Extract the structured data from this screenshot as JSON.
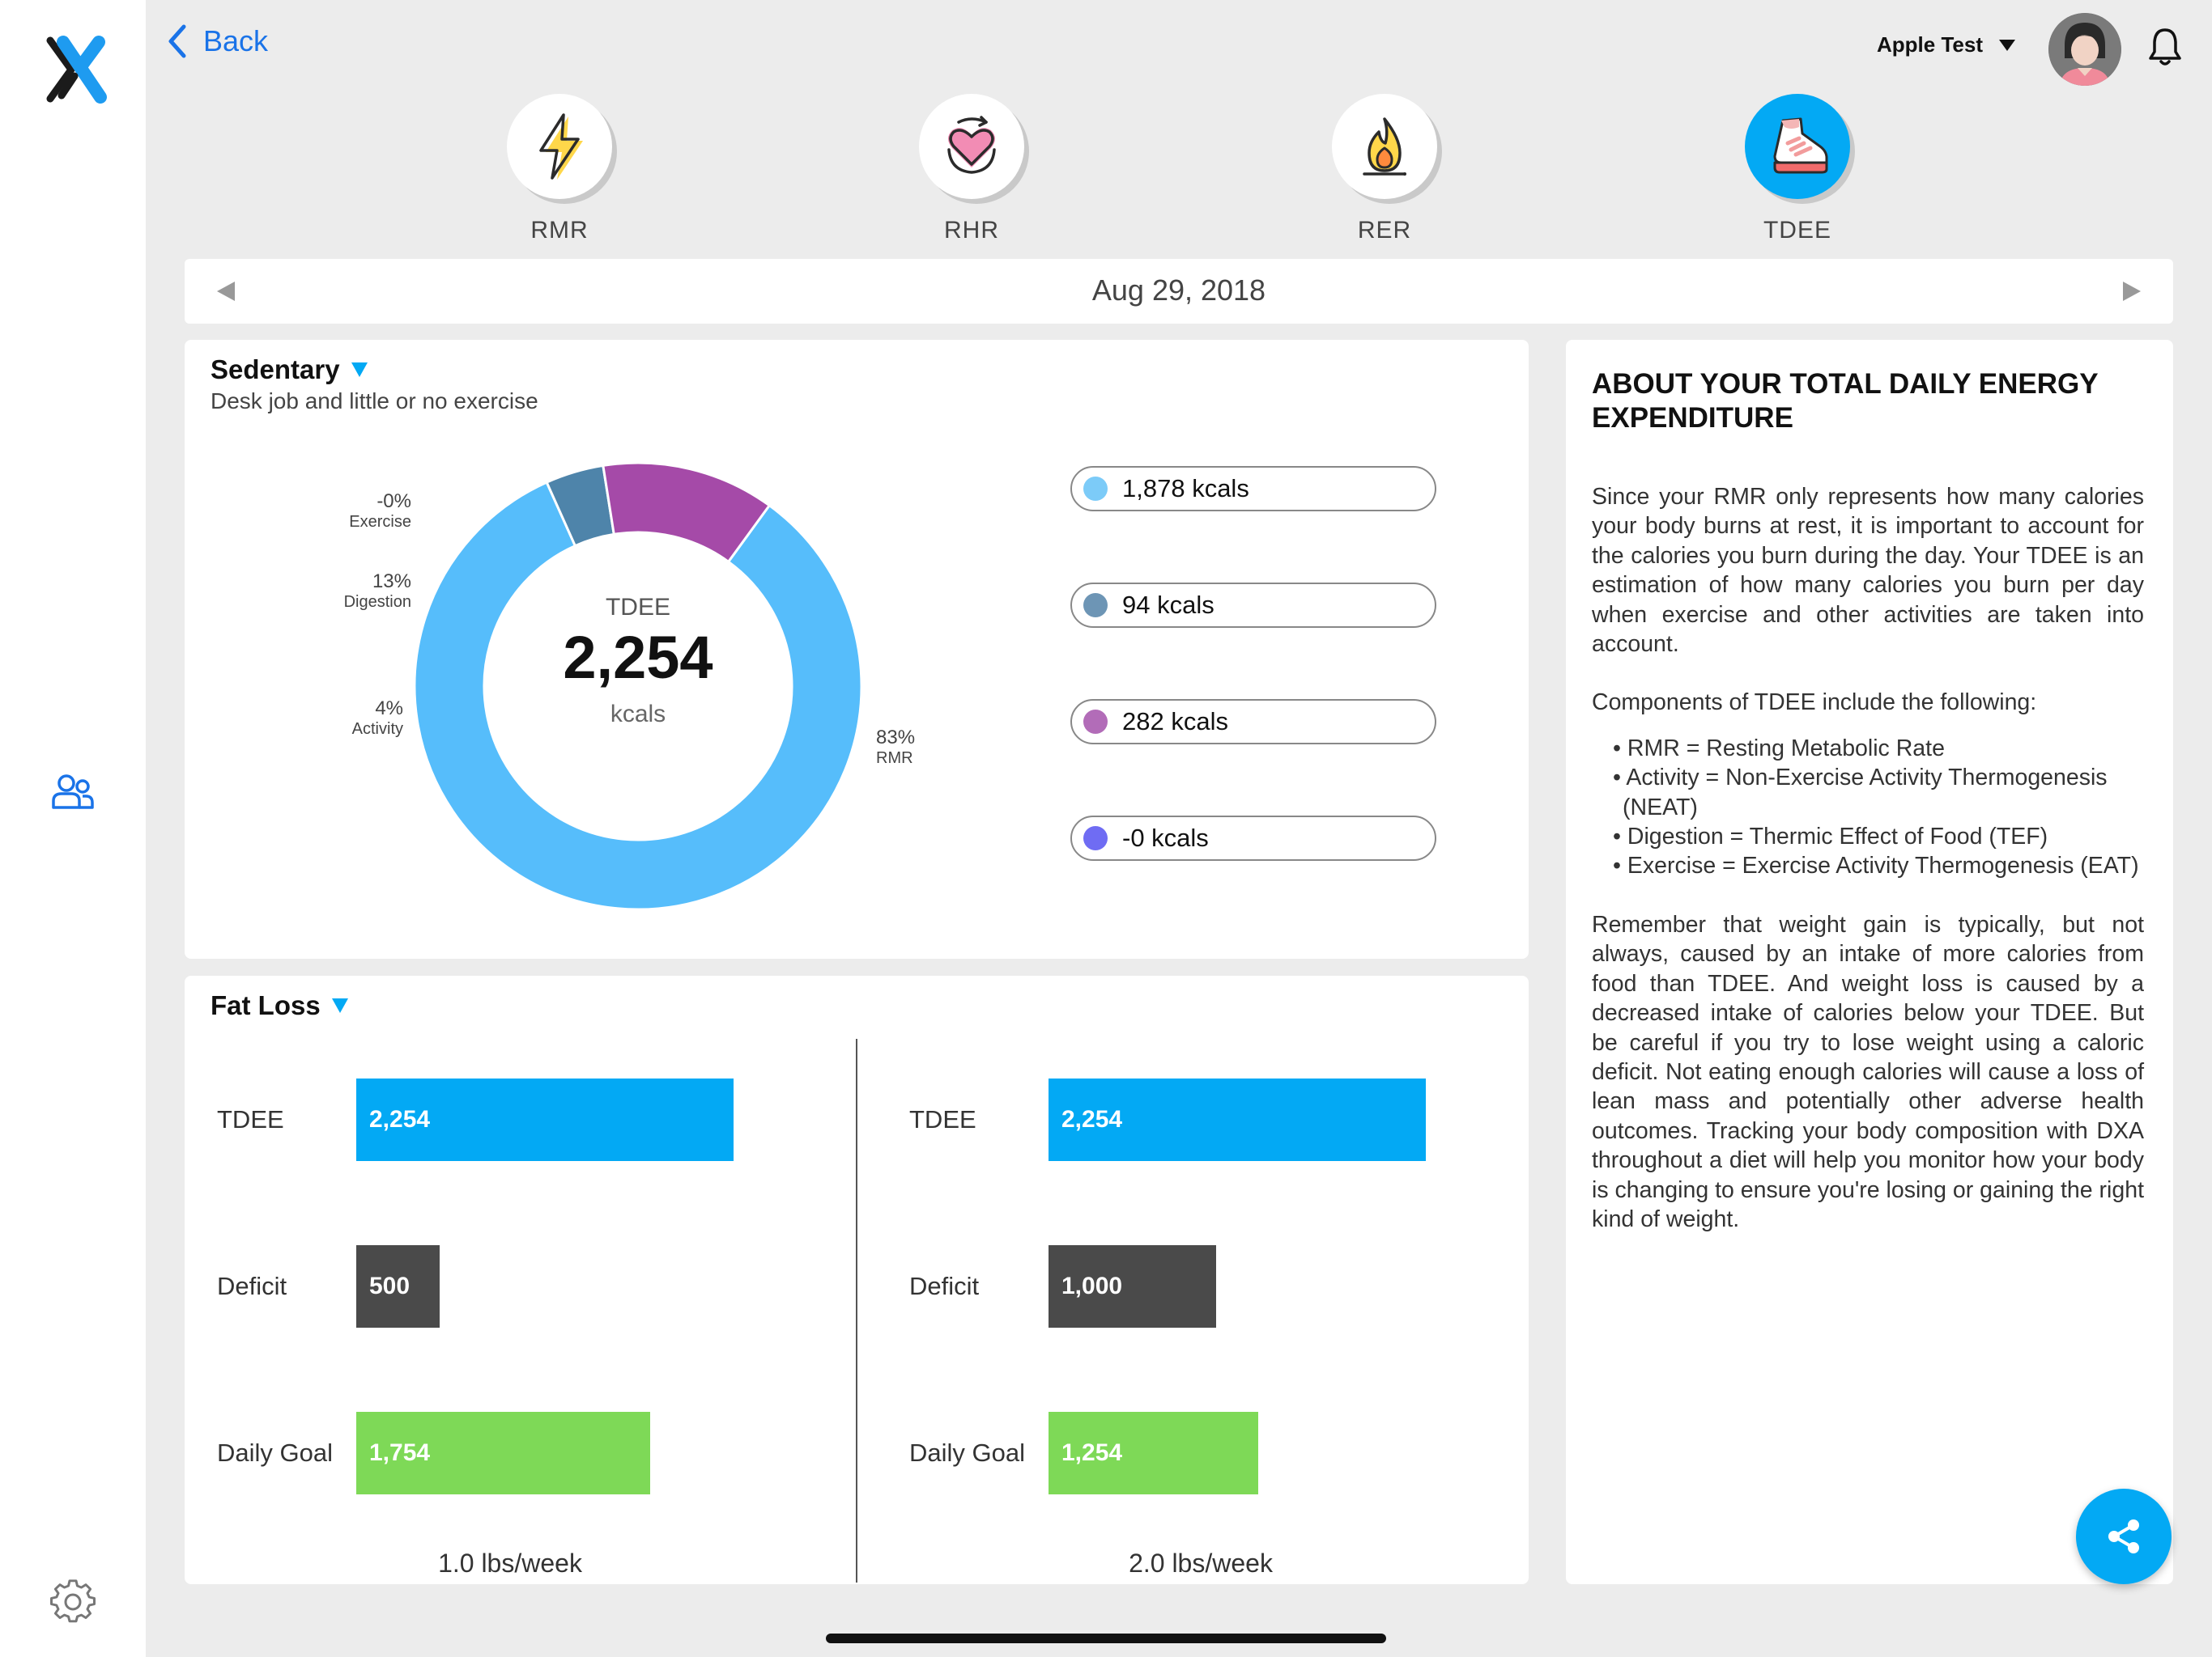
{
  "nav": {
    "back_label": "Back",
    "account_name": "Apple Test"
  },
  "metrics": [
    {
      "label": "RMR",
      "icon": "lightning-icon",
      "active": false
    },
    {
      "label": "RHR",
      "icon": "heart-rate-icon",
      "active": false
    },
    {
      "label": "RER",
      "icon": "flame-icon",
      "active": false
    },
    {
      "label": "TDEE",
      "icon": "running-shoe-icon",
      "active": true
    }
  ],
  "date": "Aug 29, 2018",
  "activity_level": {
    "title": "Sedentary",
    "description": "Desk job and little or no exercise"
  },
  "tdee": {
    "title": "TDEE",
    "value": "2,254",
    "unit": "kcals",
    "segments": [
      {
        "pct_label": "83%",
        "name": "RMR",
        "kcals": "1,878 kcals",
        "fraction": 0.833,
        "color": "#56bdfb",
        "legend_color": "#7ccbf8"
      },
      {
        "pct_label": "4%",
        "name": "Activity",
        "kcals": "94 kcals",
        "fraction": 0.042,
        "color": "#4e84aa",
        "legend_color": "#6d95b5"
      },
      {
        "pct_label": "13%",
        "name": "Digestion",
        "kcals": "282 kcals",
        "fraction": 0.125,
        "color": "#a54aa8",
        "legend_color": "#b26cb8"
      },
      {
        "pct_label": "-0%",
        "name": "Exercise",
        "kcals": "-0 kcals",
        "fraction": 0.0,
        "color": "#6f6cf3",
        "legend_color": "#6f6cf3"
      }
    ]
  },
  "fat_loss": {
    "title": "Fat Loss",
    "plans": [
      {
        "rows": [
          {
            "label": "TDEE",
            "value": "2,254",
            "amount": 2254,
            "color": "#03a9f4"
          },
          {
            "label": "Deficit",
            "value": "500",
            "amount": 500,
            "color": "#4a4a4a"
          },
          {
            "label": "Daily Goal",
            "value": "1,754",
            "amount": 1754,
            "color": "#7ed957"
          }
        ],
        "rate": "1.0 lbs/week"
      },
      {
        "rows": [
          {
            "label": "TDEE",
            "value": "2,254",
            "amount": 2254,
            "color": "#03a9f4"
          },
          {
            "label": "Deficit",
            "value": "1,000",
            "amount": 1000,
            "color": "#4a4a4a"
          },
          {
            "label": "Daily Goal",
            "value": "1,254",
            "amount": 1254,
            "color": "#7ed957"
          }
        ],
        "rate": "2.0 lbs/week"
      }
    ]
  },
  "about": {
    "title": "ABOUT YOUR TOTAL DAILY ENERGY EXPENDITURE",
    "p1": "Since your RMR only represents how many calories your body burns at rest, it is important to account for the calories you burn during the day. Your TDEE is an estimation of how many calories you burn per day when exercise and other activities are taken into account.",
    "p2": "Components of TDEE include the following:",
    "list": [
      "• RMR = Resting Metabolic Rate",
      "• Activity = Non-Exercise Activity Thermogenesis (NEAT)",
      "• Digestion = Thermic Effect of Food (TEF)",
      "• Exercise = Exercise Activity Thermogenesis (EAT)"
    ],
    "p3": "Remember that weight gain is typically, but not always, caused by an intake of more calories from food than TDEE. And weight loss is caused by a decreased intake of calories below your TDEE. But be careful if you try to lose weight using a caloric deficit. Not eating enough calories will cause a loss of lean mass and potentially other adverse health outcomes. Tracking your body composition with DXA throughout a diet will help you monitor how your body is changing to ensure you're losing or gaining the right kind of weight."
  },
  "icons": {
    "logo": "app-logo",
    "users": "users-icon",
    "settings": "gear-icon",
    "notifications": "bell-icon",
    "share": "share-icon"
  },
  "colors": {
    "accent": "#03a9f4",
    "link": "#1a73e8"
  }
}
